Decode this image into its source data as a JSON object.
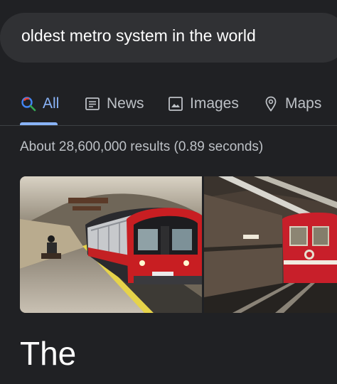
{
  "search": {
    "query": "oldest metro system in the world"
  },
  "tabs": [
    {
      "label": "All",
      "icon": "search-icon",
      "active": true
    },
    {
      "label": "News",
      "icon": "news-icon",
      "active": false
    },
    {
      "label": "Images",
      "icon": "image-icon",
      "active": false
    },
    {
      "label": "Maps",
      "icon": "location-pin-icon",
      "active": false
    }
  ],
  "results": {
    "stats": "About 28,600,000 results (0.89 seconds)"
  },
  "images": [
    {
      "subject": "London Underground train at station platform"
    },
    {
      "subject": "Red Tünel funicular train in tunnel"
    }
  ],
  "answer": {
    "text": "The"
  },
  "colors": {
    "background": "#202124",
    "accent": "#8ab4f8",
    "searchbar": "#303134",
    "muted_text": "#bdc1c6"
  }
}
